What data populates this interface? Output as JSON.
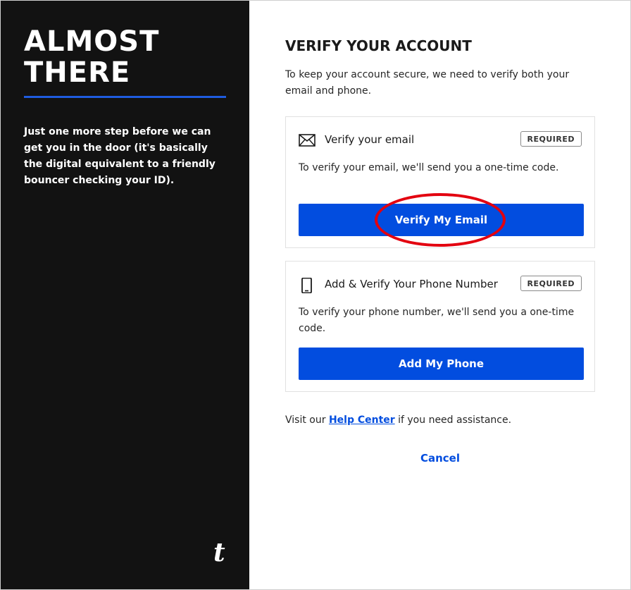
{
  "left_panel": {
    "headline_line1": "ALMOST",
    "headline_line2": "THERE",
    "intro": "Just one more step before we can get you in the door (it's basically the digital equivalent to a friendly bouncer checking your ID).",
    "logo": "t"
  },
  "main": {
    "title": "VERIFY YOUR ACCOUNT",
    "subtitle": "To keep your account secure, we need to verify both your email and phone."
  },
  "email_card": {
    "icon": "envelope-icon",
    "title": "Verify your email",
    "badge": "REQUIRED",
    "description": "To verify your email, we'll send you a one-time code.",
    "button_label": "Verify My Email"
  },
  "phone_card": {
    "icon": "phone-icon",
    "title": "Add & Verify Your Phone Number",
    "badge": "REQUIRED",
    "description": "To verify your phone number, we'll send you a one-time code.",
    "button_label": "Add My Phone"
  },
  "help": {
    "prefix": "Visit our",
    "link": "Help Center",
    "suffix": "if you need assistance."
  },
  "cancel_label": "Cancel",
  "colors": {
    "accent": "#024ddf",
    "left_bg": "#121212",
    "highlight": "#e3000f"
  }
}
